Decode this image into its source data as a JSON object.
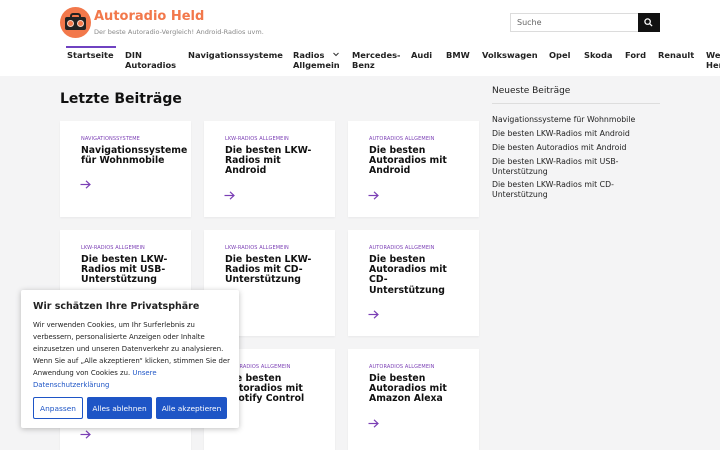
{
  "site": {
    "title": "Autoradio Held",
    "tagline": "Der beste Autoradio-Vergleich! Android-Radios uvm."
  },
  "search": {
    "placeholder": "Suche"
  },
  "nav": {
    "items": [
      {
        "label": "Startseite"
      },
      {
        "label": "DIN Autoradios"
      },
      {
        "label": "Navigationssysteme"
      },
      {
        "label": "Radios Allgemein"
      },
      {
        "label": "Mercedes-Benz"
      },
      {
        "label": "Audi"
      },
      {
        "label": "BMW"
      },
      {
        "label": "Volkswagen"
      },
      {
        "label": "Opel"
      },
      {
        "label": "Skoda"
      },
      {
        "label": "Ford"
      },
      {
        "label": "Renault"
      },
      {
        "label": "Weitere Hersteller"
      }
    ]
  },
  "main": {
    "heading": "Letzte Beiträge",
    "posts": [
      {
        "category": "NAVIGATIONSSYSTEME",
        "title": "Navigationssysteme für Wohnmobile"
      },
      {
        "category": "LKW-RADIOS ALLGEMEIN",
        "title": "Die besten LKW-Radios mit Android"
      },
      {
        "category": "AUTORADIOS ALLGEMEIN",
        "title": "Die besten Autoradios mit Android"
      },
      {
        "category": "LKW-RADIOS ALLGEMEIN",
        "title": "Die besten LKW-Radios mit USB-Unterstützung"
      },
      {
        "category": "LKW-RADIOS ALLGEMEIN",
        "title": "Die besten LKW-Radios mit CD-Unterstützung"
      },
      {
        "category": "AUTORADIOS ALLGEMEIN",
        "title": "Die besten Autoradios mit CD-Unterstützung"
      },
      {
        "category": "AUTORADIOS ALLGEMEIN",
        "title": "Die besten Autoradios mit Spotify Control"
      },
      {
        "category": "AUTORADIOS ALLGEMEIN",
        "title": "Die besten Autoradios mit Amazon Alexa"
      }
    ]
  },
  "sidebar": {
    "title": "Neueste Beiträge",
    "links": [
      {
        "label": "Navigationssysteme für Wohnmobile"
      },
      {
        "label": "Die besten LKW-Radios mit Android"
      },
      {
        "label": "Die besten Autoradios mit Android"
      },
      {
        "label": "Die besten LKW-Radios mit USB-Unterstützung"
      },
      {
        "label": "Die besten LKW-Radios mit CD-Unterstützung"
      }
    ]
  },
  "cookie": {
    "title": "Wir schätzen Ihre Privatsphäre",
    "text": "Wir verwenden Cookies, um Ihr Surferlebnis zu verbessern, personalisierte Anzeigen oder Inhalte einzusetzen und unseren Datenverkehr zu analysieren. Wenn Sie auf „Alle akzeptieren“ klicken, stimmen Sie der Anwendung von Cookies zu.",
    "link": "Unsere Datenschutzerklärung",
    "btn_customize": "Anpassen",
    "btn_reject": "Alles ablehnen",
    "btn_accept": "Alle akzeptieren"
  },
  "colors": {
    "brand": "#f2784b",
    "accent": "#6f42c1",
    "button": "#1e55c6"
  }
}
